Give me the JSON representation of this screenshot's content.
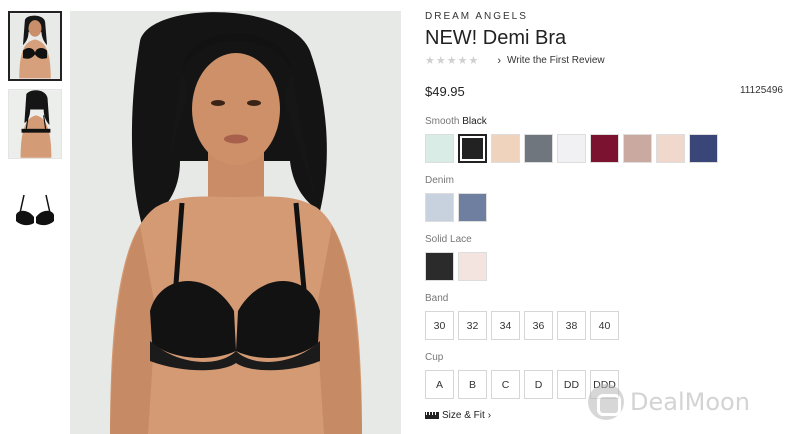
{
  "product": {
    "collection": "DREAM ANGELS",
    "title": "NEW! Demi Bra",
    "stars": "★★★★★",
    "review_link": "Write the First Review",
    "price": "$49.95",
    "sku": "11125496"
  },
  "colors": {
    "smooth": {
      "label": "Smooth",
      "selected": "Black",
      "swatches": [
        "#d9ece6",
        "#222222",
        "#efd3bd",
        "#6f767e",
        "#f1f1f3",
        "#7a1230",
        "#caa9a0",
        "#f0d8cc",
        "#3a4578"
      ]
    },
    "denim": {
      "label": "Denim",
      "swatches": [
        "#c8d2df",
        "#6f7f9f"
      ]
    },
    "lace": {
      "label": "Solid Lace",
      "swatches": [
        "#2b2b2b",
        "#f4e4df"
      ]
    }
  },
  "band": {
    "label": "Band",
    "options": [
      "30",
      "32",
      "34",
      "36",
      "38",
      "40"
    ]
  },
  "cup": {
    "label": "Cup",
    "options": [
      "A",
      "B",
      "C",
      "D",
      "DD",
      "DDD"
    ]
  },
  "size_fit": "Size & Fit",
  "watermark": "DealMoon"
}
